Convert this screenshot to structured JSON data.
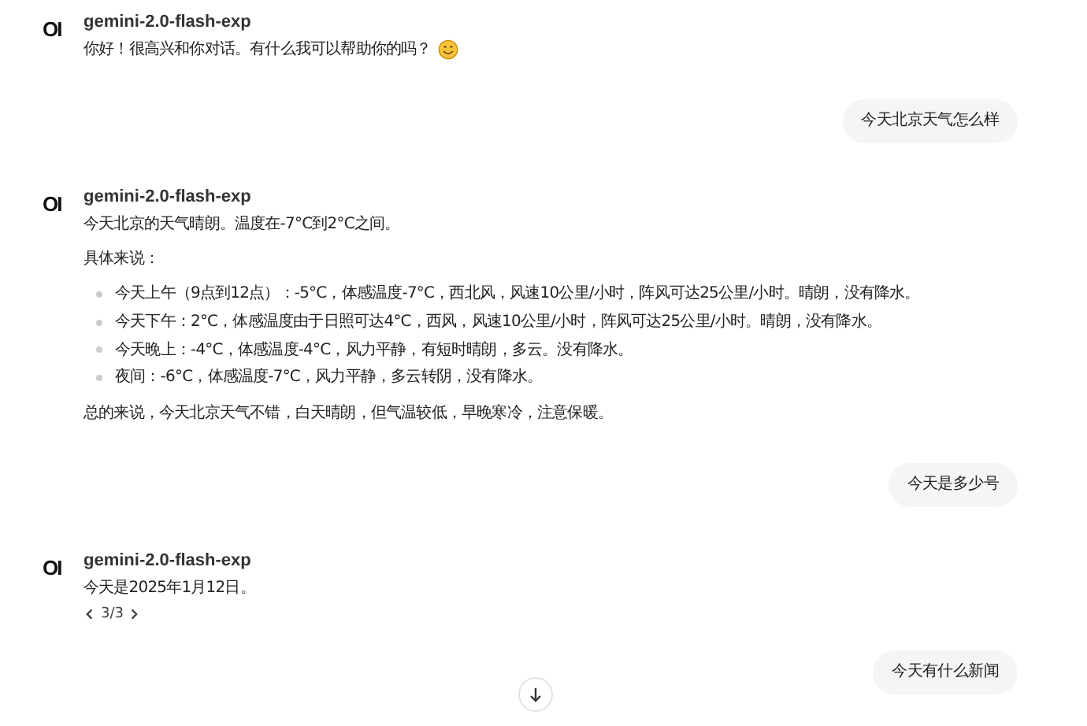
{
  "messages": [
    {
      "kind": "assistant",
      "avatar": "OI",
      "model": "gemini-2.0-flash-exp",
      "emoji": true,
      "blocks": [
        {
          "kind": "paragraph",
          "text": "你好！很高兴和你对话。有什么我可以帮助你的吗？"
        }
      ]
    },
    {
      "kind": "user",
      "text": "今天北京天气怎么样"
    },
    {
      "kind": "assistant",
      "avatar": "OI",
      "model": "gemini-2.0-flash-exp",
      "blocks": [
        {
          "kind": "paragraph",
          "text": "今天北京的天气晴朗。温度在-7°C到2°C之间。"
        },
        {
          "kind": "paragraph",
          "text": "具体来说："
        },
        {
          "kind": "list",
          "items": [
            "今天上午（9点到12点）：-5°C，体感温度-7°C，西北风，风速10公里/小时，阵风可达25公里/小时。晴朗，没有降水。",
            "今天下午：2°C，体感温度由于日照可达4°C，西风，风速10公里/小时，阵风可达25公里/小时。晴朗，没有降水。",
            "今天晚上：-4°C，体感温度-4°C，风力平静，有短时晴朗，多云。没有降水。",
            "夜间：-6°C，体感温度-7°C，风力平静，多云转阴，没有降水。"
          ]
        },
        {
          "kind": "paragraph",
          "text": "总的来说，今天北京天气不错，白天晴朗，但气温较低，早晚寒冷，注意保暖。"
        }
      ]
    },
    {
      "kind": "user",
      "text": "今天是多少号"
    },
    {
      "kind": "assistant",
      "avatar": "OI",
      "model": "gemini-2.0-flash-exp",
      "blocks": [
        {
          "kind": "paragraph",
          "text": "今天是2025年1月12日。"
        }
      ],
      "pager": "3/3"
    },
    {
      "kind": "user",
      "text": "今天有什么新闻"
    }
  ]
}
